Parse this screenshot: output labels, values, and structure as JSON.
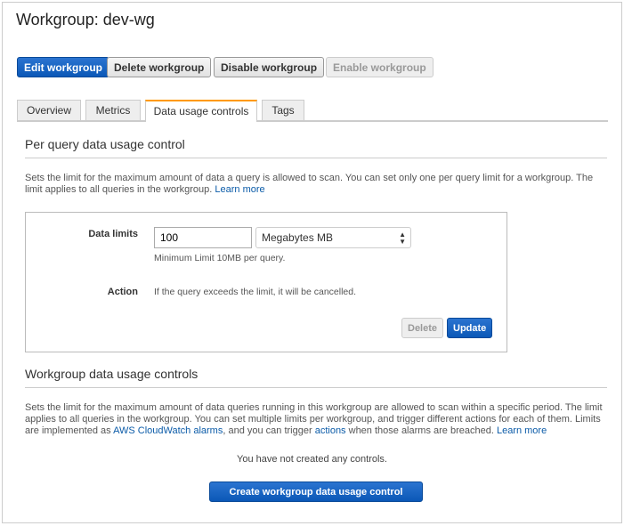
{
  "title": "Workgroup: dev-wg",
  "actions": {
    "edit": "Edit workgroup",
    "delete": "Delete workgroup",
    "disable": "Disable workgroup",
    "enable": "Enable workgroup"
  },
  "tabs": [
    "Overview",
    "Metrics",
    "Data usage controls",
    "Tags"
  ],
  "per_query": {
    "title": "Per query data usage control",
    "desc": "Sets the limit for the maximum amount of data a query is allowed to scan. You can set only one per query limit for a workgroup. The limit applies to all queries in the workgroup.",
    "learn_more": "Learn more",
    "data_limits_label": "Data limits",
    "data_limits_value": "100",
    "unit": "Megabytes MB",
    "hint": "Minimum Limit 10MB per query.",
    "action_label": "Action",
    "action_text": "If the query exceeds the limit, it will be cancelled.",
    "delete": "Delete",
    "update": "Update"
  },
  "workgroup_controls": {
    "title": "Workgroup data usage controls",
    "desc_1": "Sets the limit for the maximum amount of data queries running in this workgroup are allowed to scan within a specific period. The limit applies to all queries in the workgroup. You can set multiple limits per workgroup, and trigger different actions for each of them. Limits are implemented as",
    "link_alarms": "AWS CloudWatch alarms",
    "desc_2": ", and you can trigger",
    "link_actions": "actions",
    "desc_3": "when those alarms are breached.",
    "learn_more": "Learn more",
    "empty": "You have not created any controls.",
    "create": "Create workgroup data usage control"
  }
}
